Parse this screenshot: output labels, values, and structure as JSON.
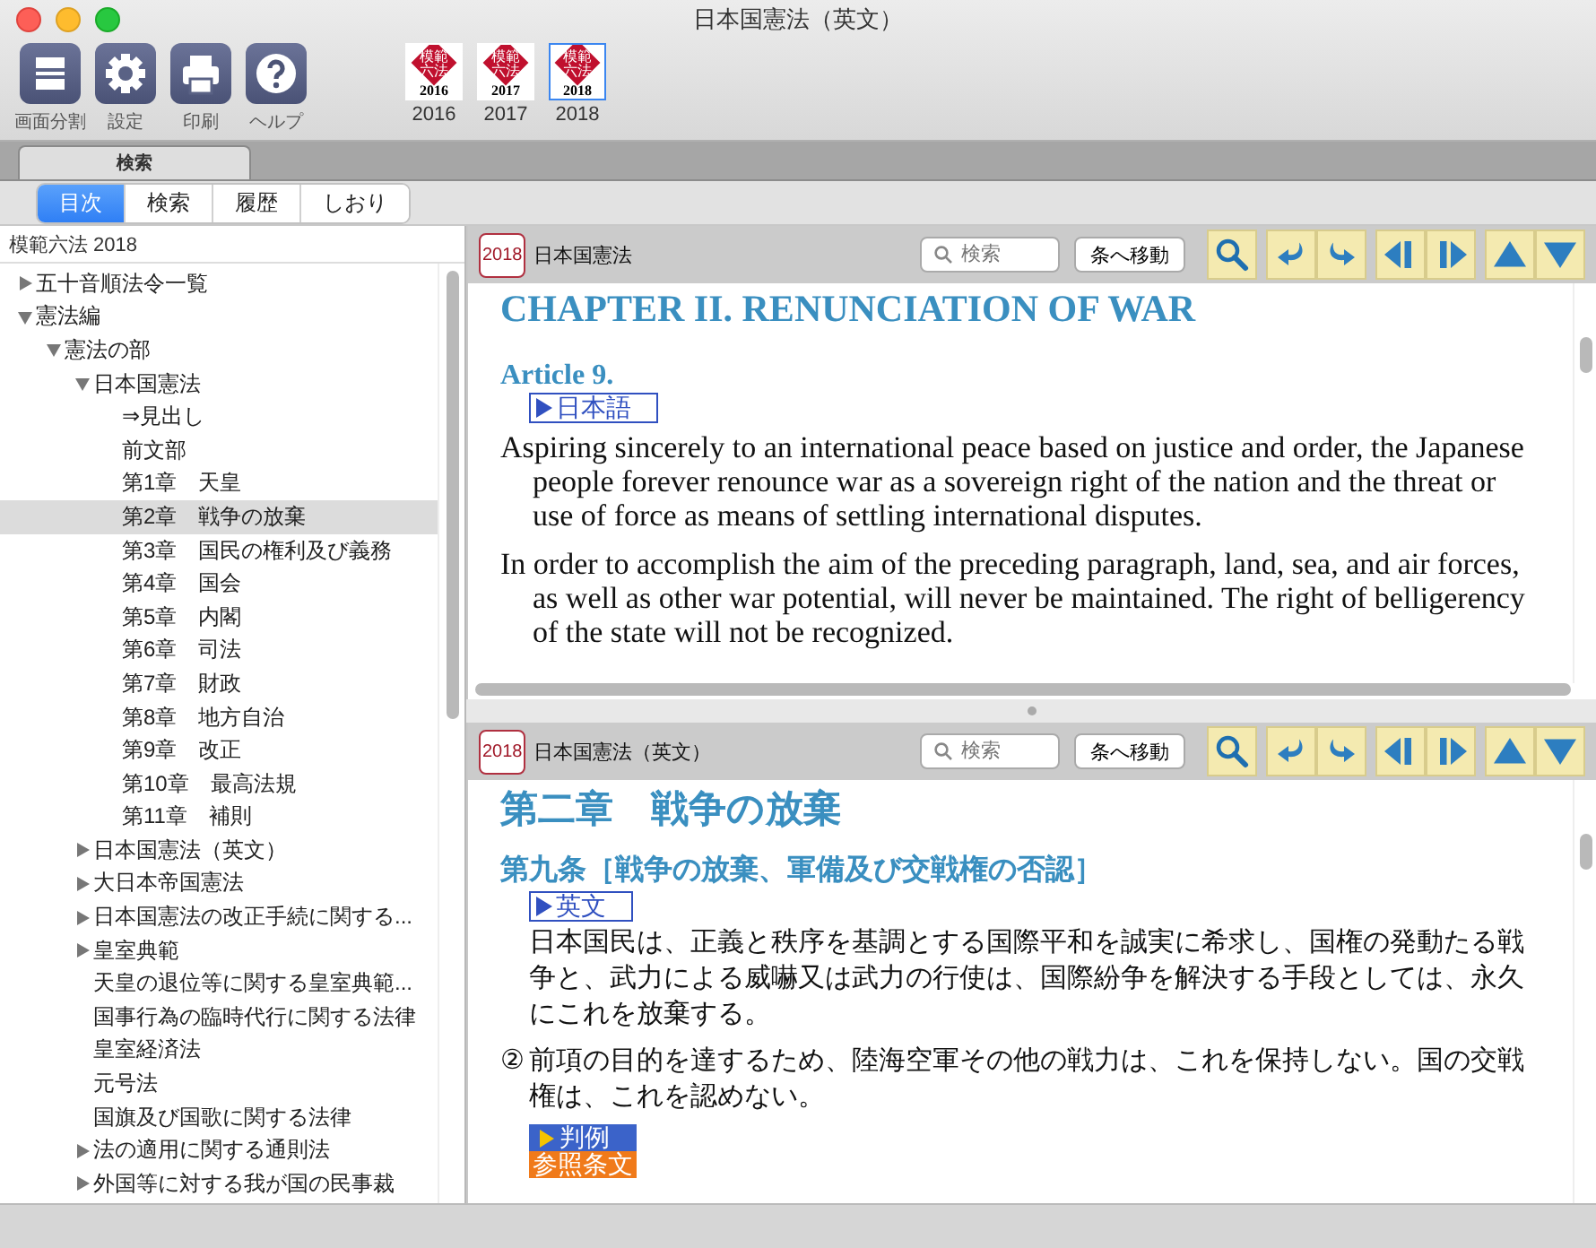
{
  "window": {
    "title": "日本国憲法（英文）"
  },
  "toolbar": {
    "buttons": [
      {
        "kind": "split",
        "label": "画面分割"
      },
      {
        "kind": "settings",
        "label": "設定"
      },
      {
        "kind": "print",
        "label": "印刷"
      },
      {
        "kind": "help",
        "label": "ヘルプ"
      }
    ],
    "editions": [
      {
        "logo": "模範六法",
        "year": "2016",
        "label": "2016",
        "selected": false
      },
      {
        "logo": "模範六法",
        "year": "2017",
        "label": "2017",
        "selected": false
      },
      {
        "logo": "模範六法",
        "year": "2018",
        "label": "2018",
        "selected": true
      }
    ]
  },
  "search_tab": {
    "label": "検索"
  },
  "segments": [
    {
      "label": "目次",
      "selected": true
    },
    {
      "label": "検索",
      "selected": false
    },
    {
      "label": "履歴",
      "selected": false
    },
    {
      "label": "しおり",
      "selected": false
    }
  ],
  "sidebar": {
    "header": "模範六法 2018",
    "tree": [
      {
        "label": "五十音順法令一覧",
        "expanded": false,
        "selected": false
      },
      {
        "label": "憲法編",
        "expanded": true,
        "selected": false,
        "children": [
          {
            "label": "憲法の部",
            "expanded": true,
            "selected": false,
            "children": [
              {
                "label": "日本国憲法",
                "expanded": true,
                "selected": false,
                "children": [
                  {
                    "label": "⇒見出し",
                    "selected": false
                  },
                  {
                    "label": "前文部",
                    "selected": false
                  },
                  {
                    "label": "第1章　天皇",
                    "selected": false
                  },
                  {
                    "label": "第2章　戦争の放棄",
                    "selected": true
                  },
                  {
                    "label": "第3章　国民の権利及び義務",
                    "selected": false
                  },
                  {
                    "label": "第4章　国会",
                    "selected": false
                  },
                  {
                    "label": "第5章　内閣",
                    "selected": false
                  },
                  {
                    "label": "第6章　司法",
                    "selected": false
                  },
                  {
                    "label": "第7章　財政",
                    "selected": false
                  },
                  {
                    "label": "第8章　地方自治",
                    "selected": false
                  },
                  {
                    "label": "第9章　改正",
                    "selected": false
                  },
                  {
                    "label": "第10章　最高法規",
                    "selected": false
                  },
                  {
                    "label": "第11章　補則",
                    "selected": false
                  }
                ]
              },
              {
                "label": "日本国憲法（英文）",
                "expanded": false,
                "selected": false
              },
              {
                "label": "大日本帝国憲法",
                "expanded": false,
                "selected": false
              },
              {
                "label": "日本国憲法の改正手続に関する...",
                "expanded": false,
                "selected": false
              },
              {
                "label": "皇室典範",
                "expanded": false,
                "selected": false
              },
              {
                "label": "天皇の退位等に関する皇室典範...",
                "selected": false
              },
              {
                "label": "国事行為の臨時代行に関する法律",
                "selected": false
              },
              {
                "label": "皇室経済法",
                "selected": false
              },
              {
                "label": "元号法",
                "selected": false
              },
              {
                "label": "国旗及び国歌に関する法律",
                "selected": false
              },
              {
                "label": "法の適用に関する通則法",
                "expanded": false,
                "selected": false
              },
              {
                "label": "外国等に対する我が国の民事裁",
                "expanded": false,
                "selected": false
              }
            ]
          }
        ]
      }
    ]
  },
  "panes": [
    {
      "badge": "2018",
      "title": "日本国憲法",
      "search_placeholder": "検索",
      "goto_button": "条へ移動",
      "content": [
        {
          "kind": "heading",
          "text": "CHAPTER II. RENUNCIATION OF WAR"
        },
        {
          "kind": "article",
          "text": "Article 9."
        },
        {
          "kind": "link",
          "text": "日本語"
        },
        {
          "kind": "paragraph",
          "text": "Aspiring sincerely to an international peace based on justice and order, the Japanese people forever renounce war as a sovereign right of the nation and the threat or use of force as means of settling international disputes."
        },
        {
          "kind": "paragraph",
          "text": "In order to accomplish the aim of the preceding paragraph, land, sea, and air forces, as well as other war potential, will never be maintained. The right of belligerency of the state will not be recognized."
        }
      ]
    },
    {
      "badge": "2018",
      "title": "日本国憲法（英文）",
      "search_placeholder": "検索",
      "goto_button": "条へ移動",
      "content": [
        {
          "kind": "heading",
          "text": "第二章　戦争の放棄"
        },
        {
          "kind": "article",
          "text": "第九条［戦争の放棄、軍備及び交戦権の否認］"
        },
        {
          "kind": "link",
          "text": "英文"
        },
        {
          "kind": "paragraph",
          "text": "日本国民は、正義と秩序を基調とする国際平和を誠実に希求し、国権の発動たる戦争と、武力による威嚇又は武力の行使は、国際紛争を解決する手段としては、永久にこれを放棄する。"
        },
        {
          "kind": "numbered",
          "number": "②",
          "text": "前項の目的を達するため、陸海空軍その他の戦力は、これを保持しない。国の交戦権は、これを認めない。"
        },
        {
          "kind": "tag",
          "text": "判例",
          "arrow": true,
          "color": "#3b63c9"
        },
        {
          "kind": "tag",
          "text": "参照条文",
          "arrow": false,
          "color": "#f07a1a"
        }
      ]
    }
  ]
}
